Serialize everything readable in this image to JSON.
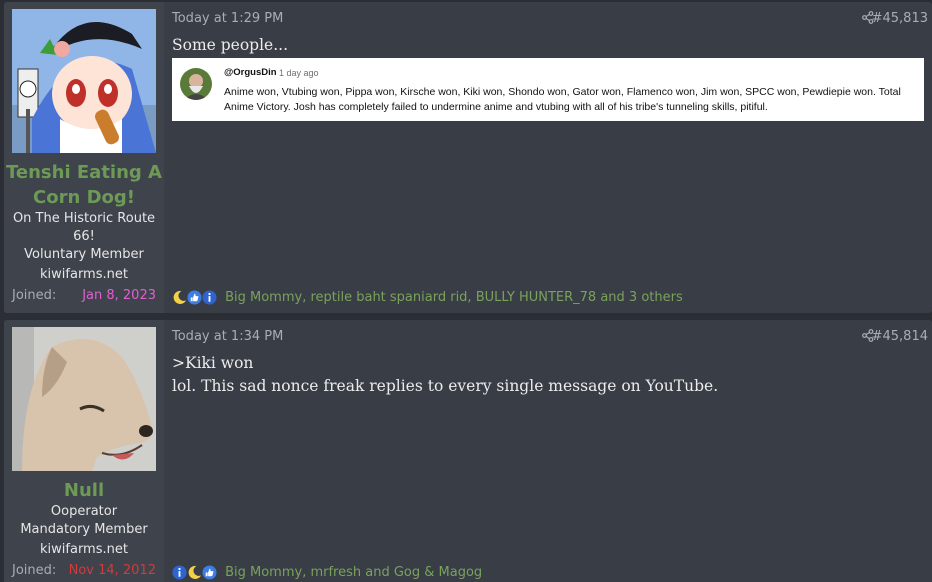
{
  "posts": [
    {
      "username": "Tenshi Eating A Corn Dog!",
      "title": "On The Historic Route 66!",
      "role": "Voluntary Member",
      "site": "kiwifarms.net",
      "joined_label": "Joined:",
      "joined_date": "Jan 8, 2023",
      "joined_color": "#e05fd1",
      "time": "Today at 1:29 PM",
      "number": "#45,813",
      "body": "Some people...",
      "embed": {
        "author": "@OrgusDin",
        "when": "1 day ago",
        "text": "Anime won, Vtubing won, Pippa won, Kirsche won, Kiki won, Shondo won, Gator won, Flamenco won, Jim won, SPCC won, Pewdiepie won. Total Anime Victory. Josh has completely failed to undermine anime and vtubing with all of his tribe's tunneling skills, pitiful."
      },
      "reactions": [
        "moon-icon",
        "thumbs-up-icon",
        "info-icon"
      ],
      "reaction_names": "Big Mommy, reptile baht spaniard rid, BULLY HUNTER_78 and 3 others"
    },
    {
      "username": "Null",
      "title": "Ooperator",
      "role": "Mandatory Member",
      "site": "kiwifarms.net",
      "joined_label": "Joined:",
      "joined_date": "Nov 14, 2012",
      "joined_color": "#d33a3a",
      "time": "Today at 1:34 PM",
      "number": "#45,814",
      "body_line1": ">Kiki won",
      "body_line2": "lol. This sad nonce freak replies to every single message on YouTube.",
      "reactions": [
        "info-icon",
        "moon-icon",
        "thumbs-up-icon"
      ],
      "reaction_names": "Big Mommy, mrfresh and Gog & Magog"
    }
  ],
  "colors": {
    "background": "#2b2e35",
    "post_bg": "#393d45",
    "userpanel_bg": "#3f434c",
    "username": "#6d9a56",
    "reaction_text": "#7aa25c"
  }
}
